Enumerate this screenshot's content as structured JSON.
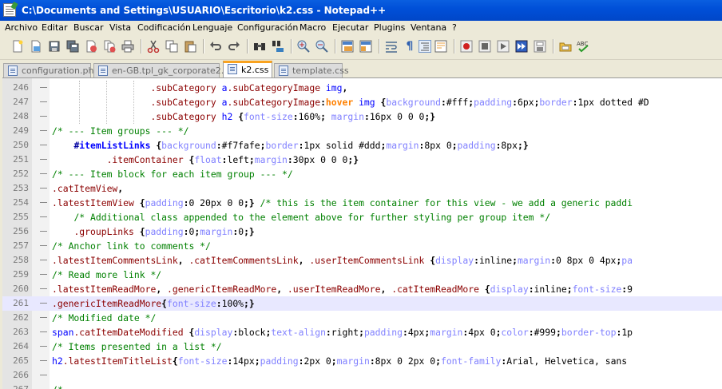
{
  "window": {
    "title": "C:\\Documents and Settings\\USUARIO\\Escritorio\\k2.css - Notepad++"
  },
  "menu": [
    "Archivo",
    "Editar",
    "Buscar",
    "Vista",
    "Codificación",
    "Lenguaje",
    "Configuración",
    "Macro",
    "Ejecutar",
    "Plugins",
    "Ventana",
    "?"
  ],
  "toolbar": {
    "icons": [
      "new-file-icon",
      "open-file-icon",
      "save-icon",
      "save-all-icon",
      "close-icon",
      "close-all-icon",
      "print-icon",
      "cut-icon",
      "copy-icon",
      "paste-icon",
      "undo-icon",
      "redo-icon",
      "find-icon",
      "replace-icon",
      "zoom-in-icon",
      "zoom-out-icon",
      "sync-vertical-icon",
      "sync-horizontal-icon",
      "word-wrap-icon",
      "show-all-chars-icon",
      "indent-guide-icon",
      "user-language-icon",
      "record-macro-icon",
      "stop-macro-icon",
      "play-macro-icon",
      "run-macro-multiple-icon",
      "save-macro-icon",
      "folder-tree-icon",
      "spell-check-icon"
    ]
  },
  "tabs": [
    {
      "label": "configuration.php",
      "active": false
    },
    {
      "label": "en-GB.tpl_gk_corporate2.ini",
      "active": false
    },
    {
      "label": "k2.css",
      "active": true
    },
    {
      "label": "template.css",
      "active": false
    }
  ],
  "editor": {
    "current_line": "261",
    "lines": [
      {
        "n": "246",
        "tokens": [
          [
            "",
            "                  "
          ],
          [
            "c-cls",
            ".subCategory"
          ],
          [
            "",
            " "
          ],
          [
            "c-tag",
            "a"
          ],
          [
            "c-cls",
            ".subCategoryImage"
          ],
          [
            "",
            " "
          ],
          [
            "c-tag",
            "img"
          ],
          [
            "c-op",
            ","
          ]
        ]
      },
      {
        "n": "247",
        "tokens": [
          [
            "",
            "                  "
          ],
          [
            "c-cls",
            ".subCategory"
          ],
          [
            "",
            " "
          ],
          [
            "c-tag",
            "a"
          ],
          [
            "c-cls",
            ".subCategoryImage"
          ],
          [
            "c-op",
            ":"
          ],
          [
            "c-pseudo",
            "hover"
          ],
          [
            "",
            " "
          ],
          [
            "c-tag",
            "img"
          ],
          [
            "",
            " "
          ],
          [
            "c-op",
            "{"
          ],
          [
            "c-prop",
            "background"
          ],
          [
            "c-op",
            ":"
          ],
          [
            "c-val",
            "#fff"
          ],
          [
            "c-op",
            ";"
          ],
          [
            "c-prop",
            "padding"
          ],
          [
            "c-op",
            ":"
          ],
          [
            "c-val",
            "6px"
          ],
          [
            "c-op",
            ";"
          ],
          [
            "c-prop",
            "border"
          ],
          [
            "c-op",
            ":"
          ],
          [
            "c-val",
            "1px dotted #D"
          ]
        ]
      },
      {
        "n": "248",
        "tokens": [
          [
            "",
            "                  "
          ],
          [
            "c-cls",
            ".subCategory"
          ],
          [
            "",
            " "
          ],
          [
            "c-tag",
            "h2"
          ],
          [
            "",
            " "
          ],
          [
            "c-op",
            "{"
          ],
          [
            "c-prop",
            "font-size"
          ],
          [
            "c-op",
            ":"
          ],
          [
            "c-val",
            "160%"
          ],
          [
            "c-op",
            ";"
          ],
          [
            "",
            " "
          ],
          [
            "c-prop",
            "margin"
          ],
          [
            "c-op",
            ":"
          ],
          [
            "c-val",
            "16px 0 0 0"
          ],
          [
            "c-op",
            ";}"
          ]
        ]
      },
      {
        "n": "249",
        "tokens": [
          [
            "c-cmt",
            "/* --- Item groups --- */"
          ]
        ]
      },
      {
        "n": "250",
        "tokens": [
          [
            "",
            "    "
          ],
          [
            "c-id",
            "#"
          ],
          [
            "c-id2",
            "itemListLinks"
          ],
          [
            "",
            " "
          ],
          [
            "c-op",
            "{"
          ],
          [
            "c-prop",
            "background"
          ],
          [
            "c-op",
            ":"
          ],
          [
            "c-val",
            "#f7fafe"
          ],
          [
            "c-op",
            ";"
          ],
          [
            "c-prop",
            "border"
          ],
          [
            "c-op",
            ":"
          ],
          [
            "c-val",
            "1px solid #ddd"
          ],
          [
            "c-op",
            ";"
          ],
          [
            "c-prop",
            "margin"
          ],
          [
            "c-op",
            ":"
          ],
          [
            "c-val",
            "8px 0"
          ],
          [
            "c-op",
            ";"
          ],
          [
            "c-prop",
            "padding"
          ],
          [
            "c-op",
            ":"
          ],
          [
            "c-val",
            "8px"
          ],
          [
            "c-op",
            ";}"
          ]
        ]
      },
      {
        "n": "251",
        "tokens": [
          [
            "",
            "          "
          ],
          [
            "c-cls",
            ".itemContainer"
          ],
          [
            "",
            " "
          ],
          [
            "c-op",
            "{"
          ],
          [
            "c-prop",
            "float"
          ],
          [
            "c-op",
            ":"
          ],
          [
            "c-val",
            "left"
          ],
          [
            "c-op",
            ";"
          ],
          [
            "c-prop",
            "margin"
          ],
          [
            "c-op",
            ":"
          ],
          [
            "c-val",
            "30px 0 0 0"
          ],
          [
            "c-op",
            ";}"
          ]
        ]
      },
      {
        "n": "252",
        "tokens": [
          [
            "c-cmt",
            "/* --- Item block for each item group --- */"
          ]
        ]
      },
      {
        "n": "253",
        "tokens": [
          [
            "c-cls",
            ".catItemView"
          ],
          [
            "c-op",
            ","
          ]
        ]
      },
      {
        "n": "254",
        "tokens": [
          [
            "c-cls",
            ".latestItemView"
          ],
          [
            "",
            " "
          ],
          [
            "c-op",
            "{"
          ],
          [
            "c-prop",
            "padding"
          ],
          [
            "c-op",
            ":"
          ],
          [
            "c-val",
            "0 20px 0 0"
          ],
          [
            "c-op",
            ";}"
          ],
          [
            "",
            " "
          ],
          [
            "c-cmt",
            "/* this is the item container for this view - we add a generic paddi"
          ]
        ]
      },
      {
        "n": "255",
        "tokens": [
          [
            "",
            "    "
          ],
          [
            "c-cmt",
            "/* Additional class appended to the element above for further styling per group item */"
          ]
        ]
      },
      {
        "n": "256",
        "tokens": [
          [
            "",
            "    "
          ],
          [
            "c-cls",
            ".groupLinks"
          ],
          [
            "",
            " "
          ],
          [
            "c-op",
            "{"
          ],
          [
            "c-prop",
            "padding"
          ],
          [
            "c-op",
            ":"
          ],
          [
            "c-val",
            "0"
          ],
          [
            "c-op",
            ";"
          ],
          [
            "c-prop",
            "margin"
          ],
          [
            "c-op",
            ":"
          ],
          [
            "c-val",
            "0"
          ],
          [
            "c-op",
            ";}"
          ]
        ]
      },
      {
        "n": "257",
        "tokens": [
          [
            "c-cmt",
            "/* Anchor link to comments */"
          ]
        ]
      },
      {
        "n": "258",
        "tokens": [
          [
            "c-cls",
            ".latestItemCommentsLink"
          ],
          [
            "c-op",
            ","
          ],
          [
            "",
            " "
          ],
          [
            "c-cls",
            ".catItemCommentsLink"
          ],
          [
            "c-op",
            ","
          ],
          [
            "",
            " "
          ],
          [
            "c-cls",
            ".userItemCommentsLink"
          ],
          [
            "",
            " "
          ],
          [
            "c-op",
            "{"
          ],
          [
            "c-prop",
            "display"
          ],
          [
            "c-op",
            ":"
          ],
          [
            "c-val",
            "inline"
          ],
          [
            "c-op",
            ";"
          ],
          [
            "c-prop",
            "margin"
          ],
          [
            "c-op",
            ":"
          ],
          [
            "c-val",
            "0 8px 0 4px"
          ],
          [
            "c-op",
            ";"
          ],
          [
            "c-prop",
            "pa"
          ]
        ]
      },
      {
        "n": "259",
        "tokens": [
          [
            "c-cmt",
            "/* Read more link */"
          ]
        ]
      },
      {
        "n": "260",
        "tokens": [
          [
            "c-cls",
            ".latestItemReadMore"
          ],
          [
            "c-op",
            ","
          ],
          [
            "",
            " "
          ],
          [
            "c-cls",
            ".genericItemReadMore"
          ],
          [
            "c-op",
            ","
          ],
          [
            "",
            " "
          ],
          [
            "c-cls",
            ".userItemReadMore"
          ],
          [
            "c-op",
            ","
          ],
          [
            "",
            " "
          ],
          [
            "c-cls",
            ".catItemReadMore"
          ],
          [
            "",
            " "
          ],
          [
            "c-op",
            "{"
          ],
          [
            "c-prop",
            "display"
          ],
          [
            "c-op",
            ":"
          ],
          [
            "c-val",
            "inline"
          ],
          [
            "c-op",
            ";"
          ],
          [
            "c-prop",
            "font-size"
          ],
          [
            "c-op",
            ":"
          ],
          [
            "c-val",
            "9"
          ]
        ]
      },
      {
        "n": "261",
        "tokens": [
          [
            "c-cls",
            ".genericItemReadMore"
          ],
          [
            "c-op",
            "{"
          ],
          [
            "c-prop",
            "font-size"
          ],
          [
            "c-op",
            ":"
          ],
          [
            "c-val",
            "100%"
          ],
          [
            "c-op",
            ";}"
          ]
        ]
      },
      {
        "n": "262",
        "tokens": [
          [
            "c-cmt",
            "/* Modified date */"
          ]
        ]
      },
      {
        "n": "263",
        "tokens": [
          [
            "c-tag",
            "span"
          ],
          [
            "c-cls",
            ".catItemDateModified"
          ],
          [
            "",
            " "
          ],
          [
            "c-op",
            "{"
          ],
          [
            "c-prop",
            "display"
          ],
          [
            "c-op",
            ":"
          ],
          [
            "c-val",
            "block"
          ],
          [
            "c-op",
            ";"
          ],
          [
            "c-prop",
            "text-align"
          ],
          [
            "c-op",
            ":"
          ],
          [
            "c-val",
            "right"
          ],
          [
            "c-op",
            ";"
          ],
          [
            "c-prop",
            "padding"
          ],
          [
            "c-op",
            ":"
          ],
          [
            "c-val",
            "4px"
          ],
          [
            "c-op",
            ";"
          ],
          [
            "c-prop",
            "margin"
          ],
          [
            "c-op",
            ":"
          ],
          [
            "c-val",
            "4px 0"
          ],
          [
            "c-op",
            ";"
          ],
          [
            "c-prop",
            "color"
          ],
          [
            "c-op",
            ":"
          ],
          [
            "c-val",
            "#999"
          ],
          [
            "c-op",
            ";"
          ],
          [
            "c-prop",
            "border-top"
          ],
          [
            "c-op",
            ":"
          ],
          [
            "c-val",
            "1p"
          ]
        ]
      },
      {
        "n": "264",
        "tokens": [
          [
            "c-cmt",
            "/* Items presented in a list */"
          ]
        ]
      },
      {
        "n": "265",
        "tokens": [
          [
            "c-tag",
            "h2"
          ],
          [
            "c-cls",
            ".latestItemTitleList"
          ],
          [
            "c-op",
            "{"
          ],
          [
            "c-prop",
            "font-size"
          ],
          [
            "c-op",
            ":"
          ],
          [
            "c-val",
            "14px"
          ],
          [
            "c-op",
            ";"
          ],
          [
            "c-prop",
            "padding"
          ],
          [
            "c-op",
            ":"
          ],
          [
            "c-val",
            "2px 0"
          ],
          [
            "c-op",
            ";"
          ],
          [
            "c-prop",
            "margin"
          ],
          [
            "c-op",
            ":"
          ],
          [
            "c-val",
            "8px 0 2px 0"
          ],
          [
            "c-op",
            ";"
          ],
          [
            "c-prop",
            "font-family"
          ],
          [
            "c-op",
            ":"
          ],
          [
            "c-val",
            "Arial, Helvetica, sans"
          ]
        ]
      },
      {
        "n": "266",
        "tokens": []
      },
      {
        "n": "267",
        "tokens": [
          [
            "c-cmt",
            "/*"
          ]
        ]
      }
    ]
  }
}
